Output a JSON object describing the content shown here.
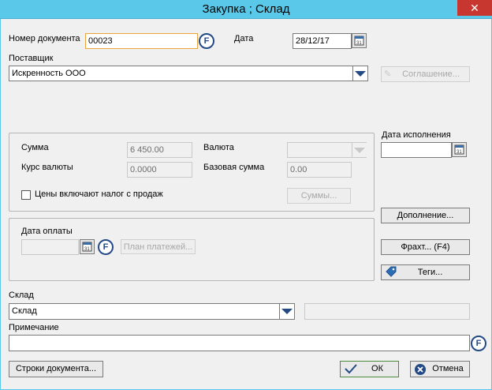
{
  "window": {
    "title": "Закупка ; Склад",
    "close": "✕"
  },
  "doc_number": {
    "label": "Номер документа",
    "value": "00023"
  },
  "date": {
    "label": "Дата",
    "value": "28/12/17"
  },
  "supplier": {
    "label": "Поставщик",
    "value": "Искренность ООО"
  },
  "agreement_button": "Соглашение...",
  "due_date": {
    "label": "Дата исполнения",
    "value": ""
  },
  "totals": {
    "sum_label": "Сумма",
    "sum_value": "6 450.00",
    "rate_label": "Курс валюты",
    "rate_value": "0.0000",
    "currency_label": "Валюта",
    "currency_value": "",
    "base_sum_label": "Базовая сумма",
    "base_sum_value": "0.00",
    "tax_checkbox_label": "Цены включают налог с продаж",
    "sums_button": "Суммы..."
  },
  "payment": {
    "label": "Дата оплаты",
    "value": "",
    "plan_button": "План платежей..."
  },
  "side_buttons": {
    "addition": "Дополнение...",
    "fact": "Фрахт... (F4)",
    "tags": "Теги..."
  },
  "warehouse": {
    "label": "Склад",
    "value": "Склад",
    "extra": ""
  },
  "note": {
    "label": "Примечание",
    "value": ""
  },
  "bottom": {
    "lines_button": "Строки документа...",
    "ok": "ОК",
    "cancel": "Отмена"
  },
  "icons": {
    "f_symbol": "F",
    "calendar": "calendar-icon",
    "check": "check-icon",
    "cancel": "cancel-icon",
    "tag": "tag-icon",
    "agreement": "agreement-icon"
  },
  "colors": {
    "title_bar": "#5ac8e8",
    "accent": "#244a86",
    "close": "#c7372f",
    "focus": "#e8a33c"
  }
}
